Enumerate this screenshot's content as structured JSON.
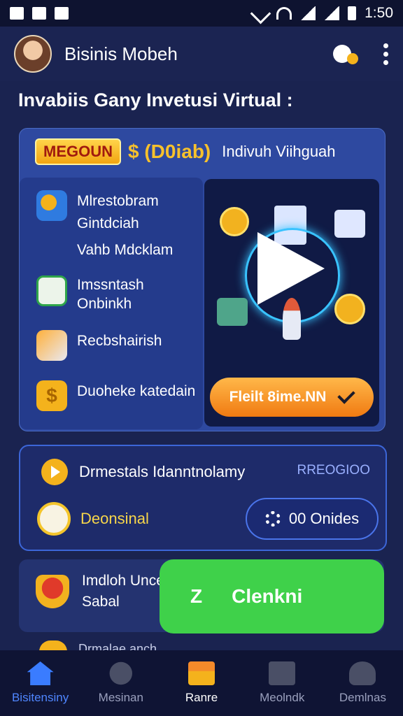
{
  "status_bar": {
    "time": "1:50"
  },
  "app_bar": {
    "title": "Bisinis Mobeh"
  },
  "heading": "Invabiis Ganу Invetusi Virtual :",
  "promo_card": {
    "badge": "MEGOUN",
    "price": "$ (D0iab)",
    "subtitle": "Indivuh Viihguah",
    "features": [
      {
        "icon": "bank-icon",
        "lines": [
          "Mlrestobram",
          "Gintdciah",
          "Vahb Mdcklam"
        ]
      },
      {
        "icon": "chart-icon",
        "lines": [
          "Imssntash",
          "Onbinkh"
        ]
      },
      {
        "icon": "rocket-icon",
        "lines": [
          "Recbshairish"
        ]
      },
      {
        "icon": "dollar-icon",
        "lines": [
          "Duoheke katedain"
        ],
        "glyph": "$"
      }
    ],
    "action_button": "Fleilt 8ime.NN"
  },
  "info_card": {
    "row_text": "Drmestals Idanntnolamy",
    "tag": "RREOGIOO",
    "sub_text": "Deonsinal",
    "button": "00 Onides"
  },
  "third_card": {
    "lines": [
      "Imdloh Unce",
      "Sabal"
    ]
  },
  "green_button": {
    "prefix": "Z",
    "label": "Clenkni"
  },
  "partial_text": "Drmalae anch",
  "nav": [
    {
      "label": "Bisitensiny",
      "icon": "home-icon",
      "state": "active"
    },
    {
      "label": "Mesinan",
      "icon": "person-icon",
      "state": "normal"
    },
    {
      "label": "Ranre",
      "icon": "shop-icon",
      "state": "highlight"
    },
    {
      "label": "Meolndk",
      "icon": "document-icon",
      "state": "normal"
    },
    {
      "label": "Demlnas",
      "icon": "user-icon",
      "state": "normal"
    }
  ],
  "colors": {
    "background": "#1a2350",
    "card": "#2e49a0",
    "accent_orange": "#f07a12",
    "accent_green": "#3fd14a",
    "nav_active": "#4f86ff"
  }
}
